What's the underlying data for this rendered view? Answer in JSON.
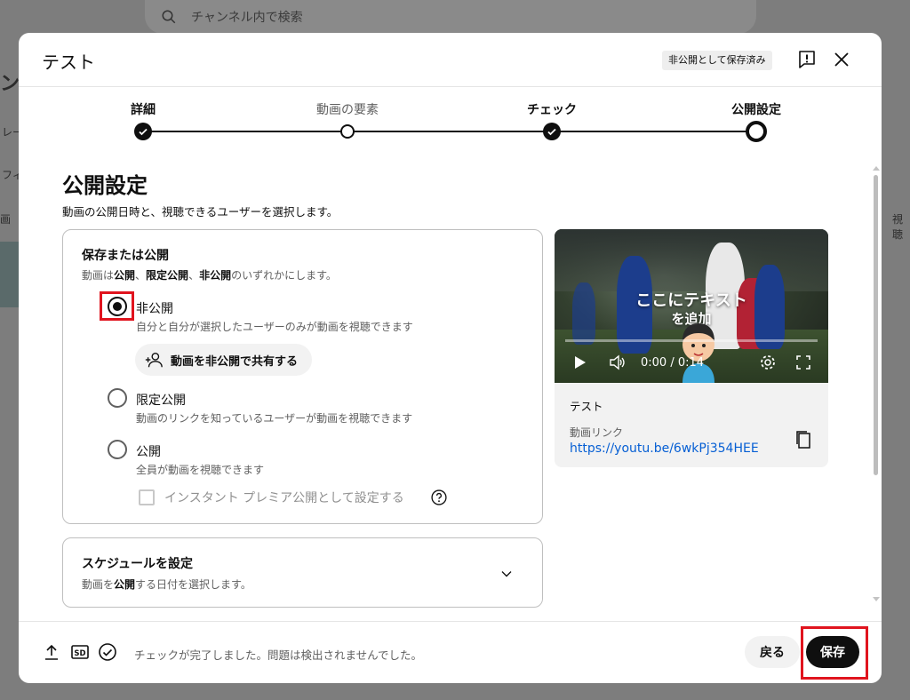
{
  "background": {
    "search_placeholder": "チャンネル内で検索",
    "frag1": "ン",
    "frag2": "レー",
    "frag3": "フィ",
    "frag4": "画",
    "frag5": "視聴"
  },
  "dialog": {
    "title": "テスト",
    "status_badge": "非公開として保存済み"
  },
  "stepper": {
    "steps": [
      {
        "label": "詳細",
        "state": "done"
      },
      {
        "label": "動画の要素",
        "state": "open"
      },
      {
        "label": "チェック",
        "state": "done"
      },
      {
        "label": "公開設定",
        "state": "current"
      }
    ]
  },
  "visibility": {
    "title": "公開設定",
    "desc": "動画の公開日時と、視聴できるユーザーを選択します。",
    "card_title": "保存または公開",
    "card_sub_pre": "動画は",
    "card_sub_b1": "公開",
    "card_sub_sep1": "、",
    "card_sub_b2": "限定公開",
    "card_sub_sep2": "、",
    "card_sub_b3": "非公開",
    "card_sub_post": "のいずれかにします。",
    "options": [
      {
        "label": "非公開",
        "desc": "自分と自分が選択したユーザーのみが動画を視聴できます",
        "checked": true
      },
      {
        "label": "限定公開",
        "desc": "動画のリンクを知っているユーザーが動画を視聴できます",
        "checked": false
      },
      {
        "label": "公開",
        "desc": "全員が動画を視聴できます",
        "checked": false
      }
    ],
    "share_button": "動画を非公開で共有する",
    "premiere_checkbox": "インスタント プレミア公開として設定する"
  },
  "schedule": {
    "title": "スケジュールを設定",
    "sub_pre": "動画を",
    "sub_b": "公開",
    "sub_post": "する日付を選択します。"
  },
  "preview": {
    "overlay_line1": "ここにテキスト",
    "overlay_line2": "を追加",
    "time": "0:00 / 0:14",
    "video_title": "テスト",
    "link_label": "動画リンク",
    "link": "https://youtu.be/6wkPj354HEE"
  },
  "footer": {
    "message": "チェックが完了しました。問題は検出されませんでした。",
    "back": "戻る",
    "save": "保存",
    "sd_label": "SD"
  },
  "colors": {
    "accent_link": "#065fd4",
    "highlight": "#e0141e",
    "primary_button": "#0f0f0f"
  }
}
